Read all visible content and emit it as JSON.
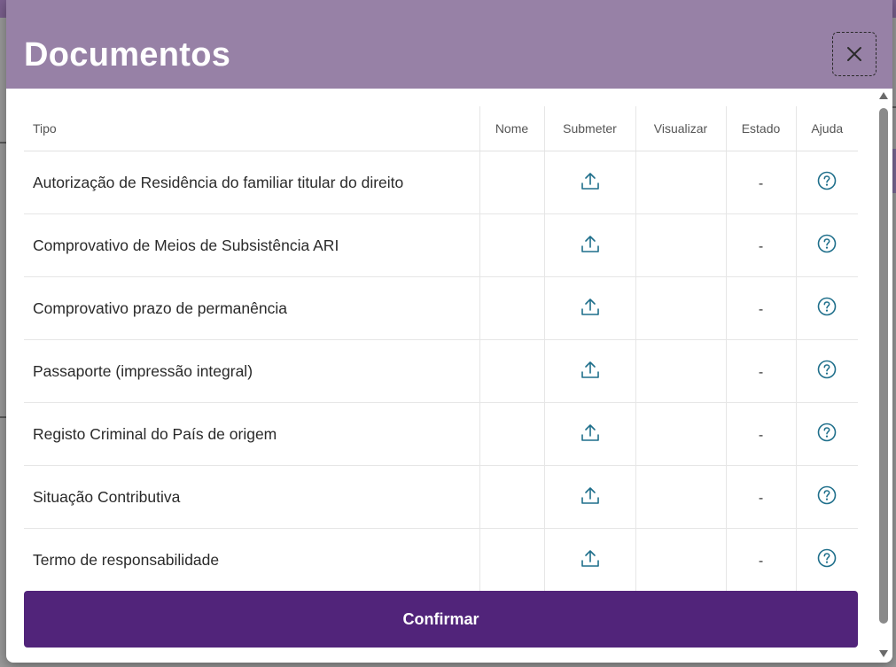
{
  "modal": {
    "title": "Documentos"
  },
  "table": {
    "headers": {
      "tipo": "Tipo",
      "nome": "Nome",
      "submeter": "Submeter",
      "visualizar": "Visualizar",
      "estado": "Estado",
      "ajuda": "Ajuda"
    },
    "rows": [
      {
        "tipo": "Autorização de Residência do familiar titular do direito",
        "nome": "",
        "visualizar": "",
        "estado": "-"
      },
      {
        "tipo": "Comprovativo de Meios de Subsistência ARI",
        "nome": "",
        "visualizar": "",
        "estado": "-"
      },
      {
        "tipo": "Comprovativo prazo de permanência",
        "nome": "",
        "visualizar": "",
        "estado": "-"
      },
      {
        "tipo": "Passaporte (impressão integral)",
        "nome": "",
        "visualizar": "",
        "estado": "-"
      },
      {
        "tipo": "Registo Criminal do País de origem",
        "nome": "",
        "visualizar": "",
        "estado": "-"
      },
      {
        "tipo": "Situação Contributiva",
        "nome": "",
        "visualizar": "",
        "estado": "-"
      },
      {
        "tipo": "Termo de responsabilidade",
        "nome": "",
        "visualizar": "",
        "estado": "-"
      }
    ]
  },
  "actions": {
    "confirm_label": "Confirmar"
  },
  "icons": {
    "close": "close-icon",
    "upload": "upload-icon",
    "help": "help-circle-icon"
  },
  "colors": {
    "header_bg": "#9781a6",
    "primary": "#51247a",
    "icon_accent": "#1f6f8b"
  }
}
